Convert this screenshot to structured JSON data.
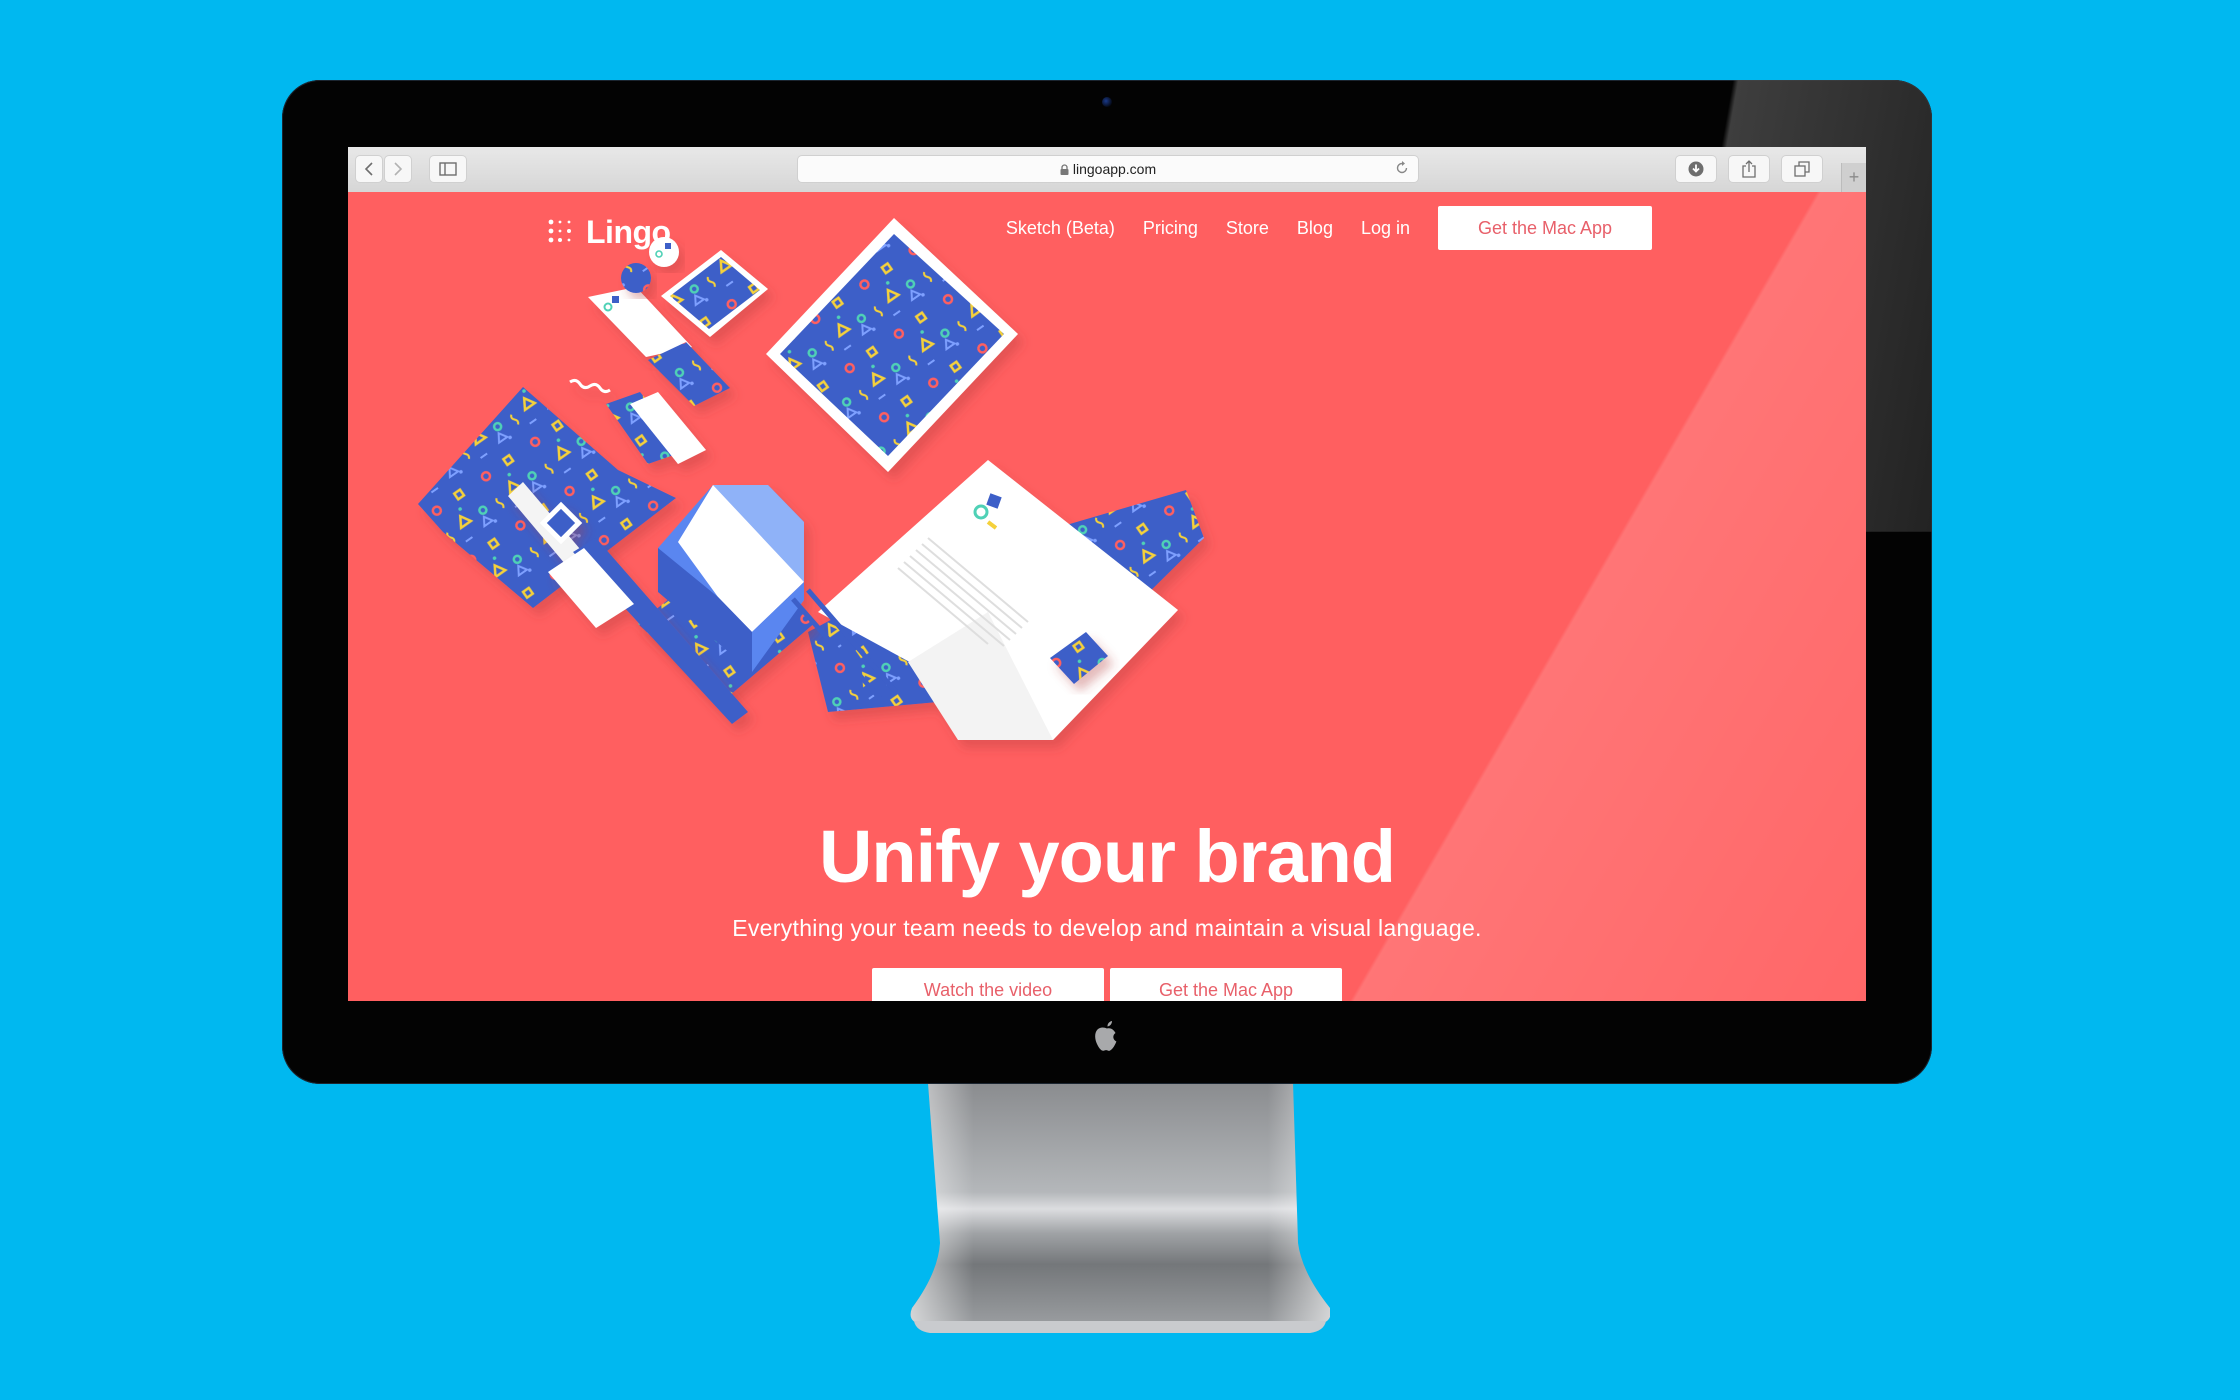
{
  "scene": {
    "background_color": "#00b8f0",
    "device": "desktop monitor"
  },
  "browser": {
    "url": "lingoapp.com",
    "secure": true,
    "toolbar_icons": [
      "chevron-left-icon",
      "chevron-right-icon",
      "sidebar-icon",
      "lock-icon",
      "reload-icon",
      "download-icon",
      "share-icon",
      "tabs-icon",
      "plus-icon"
    ],
    "new_tab_label": "+"
  },
  "site": {
    "brand_color": "#ff5f60",
    "accent_blue": "#3d5fc8",
    "logo_text": "Lingo",
    "nav": {
      "items": [
        {
          "label": "Sketch (Beta)"
        },
        {
          "label": "Pricing"
        },
        {
          "label": "Store"
        },
        {
          "label": "Blog"
        },
        {
          "label": "Log in"
        }
      ],
      "cta_label": "Get the Mac App"
    },
    "hero": {
      "title": "Unify your brand",
      "subtitle": "Everything your team needs to develop and maintain a visual language.",
      "buttons": [
        {
          "label": "Watch the video"
        },
        {
          "label": "Get the Mac App"
        }
      ],
      "illustration": "Isometric brand stationery mockups: tablet, phone, letterhead, envelope, business cards, tag, lanyard badge, watch, pencils, patterned paper"
    }
  }
}
